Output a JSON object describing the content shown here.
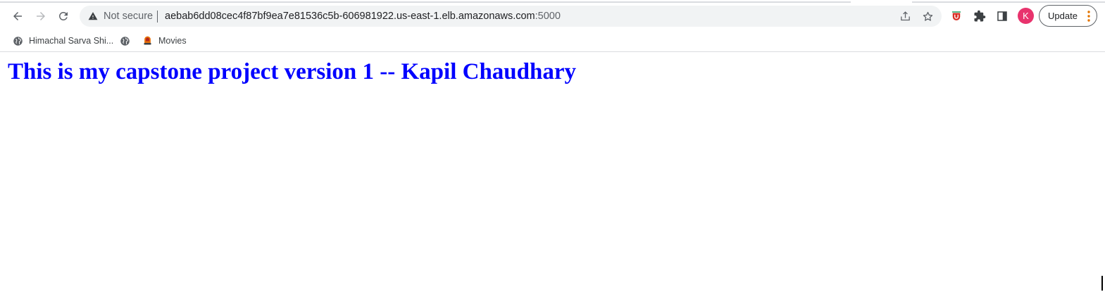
{
  "browser": {
    "security_label": "Not secure",
    "url_host": "aebab6dd08cec4f87bf9ea7e81536c5b-606981922.us-east-1.elb.amazonaws.com",
    "url_port": ":5000",
    "profile_initial": "K",
    "profile_color": "#e8336d",
    "update_label": "Update",
    "update_dots_color": "#e37400"
  },
  "bookmarks": [
    {
      "label": "Himachal Sarva Shi...",
      "icon": "globe-icon"
    },
    {
      "label": "",
      "icon": "globe-icon"
    },
    {
      "label": "Movies",
      "icon": "movies-icon"
    }
  ],
  "page": {
    "heading": "This is my capstone project version 1 -- Kapil Chaudhary",
    "heading_color": "#0000ff"
  }
}
